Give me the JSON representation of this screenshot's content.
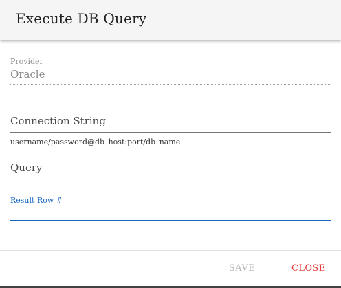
{
  "dialog": {
    "title": "Execute DB Query"
  },
  "fields": {
    "provider": {
      "label": "Provider",
      "value": "Oracle"
    },
    "connection_string": {
      "placeholder": "Connection String",
      "hint": "username/password@db_host:port/db_name"
    },
    "query": {
      "placeholder": "Query"
    },
    "result_row": {
      "label": "Result Row #",
      "value": ""
    }
  },
  "actions": {
    "save_label": "SAVE",
    "close_label": "CLOSE"
  },
  "colors": {
    "accent": "#1565c0",
    "close": "#e53935",
    "disabled": "#b5b5b5"
  }
}
